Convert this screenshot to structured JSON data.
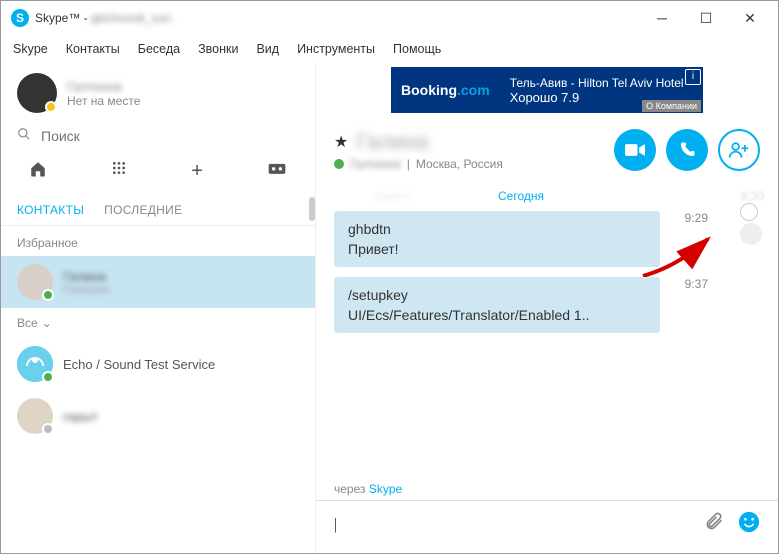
{
  "window": {
    "app_name": "Skype™",
    "username": "gkichonok_sun"
  },
  "menu": [
    "Skype",
    "Контакты",
    "Беседа",
    "Звонки",
    "Вид",
    "Инструменты",
    "Помощь"
  ],
  "profile": {
    "name": "Галчонок",
    "status": "Нет на месте"
  },
  "search": {
    "placeholder": "Поиск"
  },
  "tabs": {
    "contacts": "КОНТАКТЫ",
    "recent": "ПОСЛЕДНИЕ"
  },
  "sections": {
    "favorites": "Избранное",
    "all": "Все"
  },
  "contacts": [
    {
      "name": "Галина",
      "sub": "Галчонок"
    },
    {
      "name": "Echo / Sound Test Service",
      "sub": ""
    },
    {
      "name": "скрыт",
      "sub": ""
    }
  ],
  "ad": {
    "brand_left": "Booking",
    "brand_right": ".com",
    "line1": "Тель-Авив - Hilton Tel Aviv Hotel",
    "line2": "Хорошо 7.9",
    "about": "О Компании"
  },
  "chat_header": {
    "name": "Галина",
    "username": "Галчонок",
    "location": "Москва, Россия"
  },
  "chat": {
    "date": "Сегодня",
    "hidden_prev": "привет",
    "hidden_time": "8:30",
    "messages": [
      {
        "lines": [
          "ghbdtn",
          "Привет!"
        ],
        "time": "9:29"
      },
      {
        "lines": [
          "/setupkey",
          "UI/Ecs/Features/Translator/Enabled 1.."
        ],
        "time": "9:37"
      }
    ],
    "via_prefix": "через ",
    "via_link": "Skype",
    "input_value": "|"
  }
}
